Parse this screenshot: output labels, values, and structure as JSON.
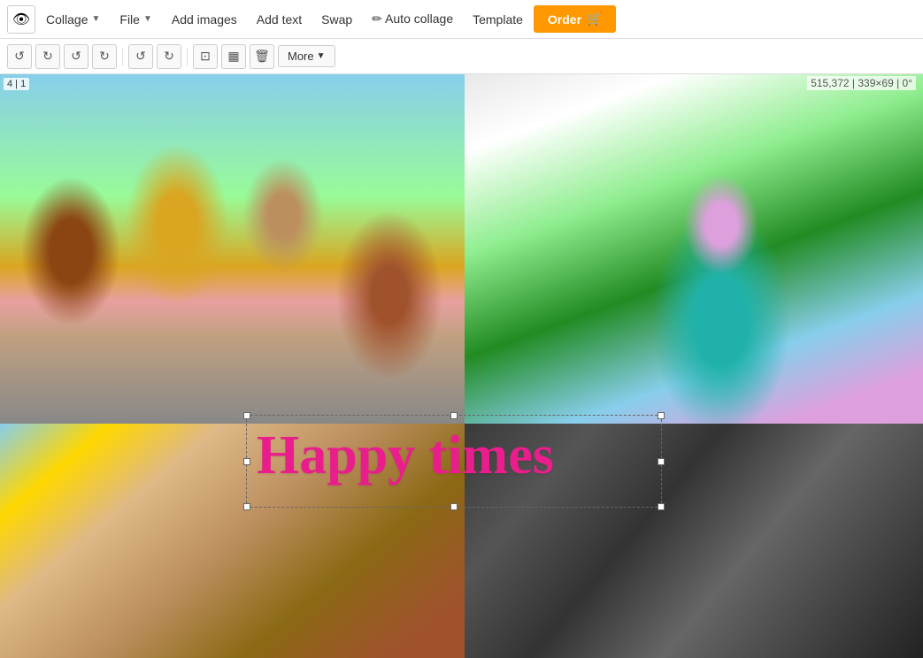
{
  "topbar": {
    "eye_label": "👁",
    "collage_label": "Collage",
    "file_label": "File",
    "add_images_label": "Add images",
    "add_text_label": "Add text",
    "swap_label": "Swap",
    "auto_collage_label": "✏ Auto collage",
    "template_label": "Template",
    "order_label": "Order",
    "order_icon": "🛒"
  },
  "toolbar": {
    "undo_label": "↺",
    "redo_label": "↻",
    "rotate_cw": "↻",
    "rotate_ccw": "↺",
    "flip_h": "⇔",
    "flip_v": "⇕",
    "crop_label": "⊡",
    "delete_label": "🗑",
    "more_label": "More"
  },
  "canvas": {
    "cell_label": "4 | 1",
    "coord_info": "515,372 | 339×69 | 0°"
  },
  "text_overlay": {
    "content": "Happy times"
  }
}
